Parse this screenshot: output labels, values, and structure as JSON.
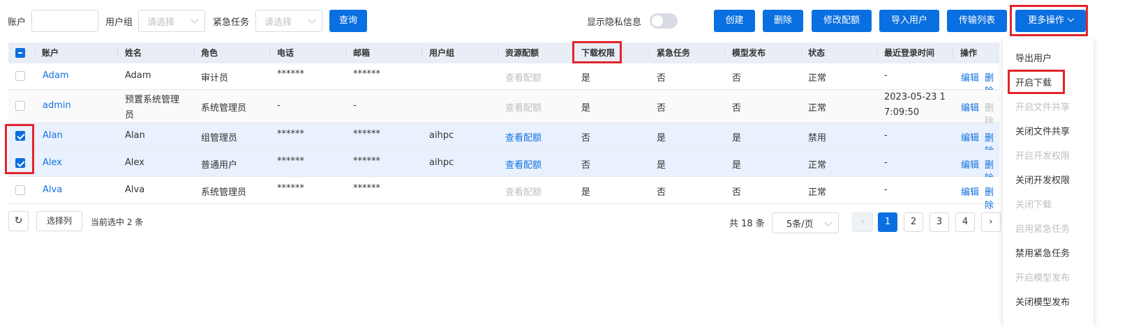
{
  "filters": {
    "account_label": "账户",
    "group_label": "用户组",
    "group_placeholder": "请选择",
    "urgent_label": "紧急任务",
    "urgent_placeholder": "请选择",
    "query_button": "查询"
  },
  "privacy": {
    "label": "显示隐私信息",
    "enabled": false
  },
  "actions": {
    "create": "创建",
    "delete": "删除",
    "edit_quota": "修改配额",
    "import_users": "导入用户",
    "transfer_list": "传输列表",
    "more_actions": "更多操作"
  },
  "table": {
    "columns": [
      "账户",
      "姓名",
      "角色",
      "电话",
      "邮箱",
      "用户组",
      "资源配额",
      "下载权限",
      "紧急任务",
      "模型发布",
      "状态",
      "最近登录时间",
      "操作"
    ],
    "rows": [
      {
        "account": "Adam",
        "name": "Adam",
        "role": "审计员",
        "phone": "******",
        "email": "******",
        "group": "",
        "quota": "查看配额",
        "download": "是",
        "urgent": "否",
        "model_pub": "否",
        "status": "正常",
        "last_login": "-",
        "edit": "编辑",
        "del": "删除"
      },
      {
        "account": "admin",
        "name_line1": "预置系统管理",
        "name_line2": "员",
        "role": "系统管理员",
        "phone": "-",
        "email": "-",
        "group": "",
        "quota": "查看配额",
        "download": "是",
        "urgent": "否",
        "model_pub": "否",
        "status": "正常",
        "last_login_line1": "2023-05-23 1",
        "last_login_line2": "7:09:50",
        "edit": "编辑",
        "del": "删除"
      },
      {
        "account": "Alan",
        "name": "Alan",
        "role": "组管理员",
        "phone": "******",
        "email": "******",
        "group": "aihpc",
        "quota": "查看配额",
        "download": "否",
        "urgent": "是",
        "model_pub": "是",
        "status": "禁用",
        "last_login": "-",
        "edit": "编辑",
        "del": "删除"
      },
      {
        "account": "Alex",
        "name": "Alex",
        "role": "普通用户",
        "phone": "******",
        "email": "******",
        "group": "aihpc",
        "quota": "查看配额",
        "download": "否",
        "urgent": "是",
        "model_pub": "是",
        "status": "正常",
        "last_login": "-",
        "edit": "编辑",
        "del": "删除"
      },
      {
        "account": "Alva",
        "name": "Alva",
        "role": "系统管理员",
        "phone": "******",
        "email": "******",
        "group": "",
        "quota": "查看配额",
        "download": "是",
        "urgent": "否",
        "model_pub": "否",
        "status": "正常",
        "last_login": "-",
        "edit": "编辑",
        "del": "删除"
      }
    ]
  },
  "footer": {
    "select_columns": "选择列",
    "selected_text": "当前选中 2 条",
    "total_text": "共 18 条",
    "page_size": "5条/页",
    "pages": [
      "1",
      "2",
      "3",
      "4"
    ]
  },
  "menu": {
    "items": [
      "导出用户",
      "开启下载",
      "开启文件共享",
      "关闭文件共享",
      "开启开发权限",
      "关闭开发权限",
      "关闭下载",
      "启用紧急任务",
      "禁用紧急任务",
      "开启模型发布",
      "关闭模型发布"
    ]
  },
  "colors": {
    "primary": "#0a6fe0",
    "highlight_red": "#e3242b",
    "link": "#1472e0"
  }
}
